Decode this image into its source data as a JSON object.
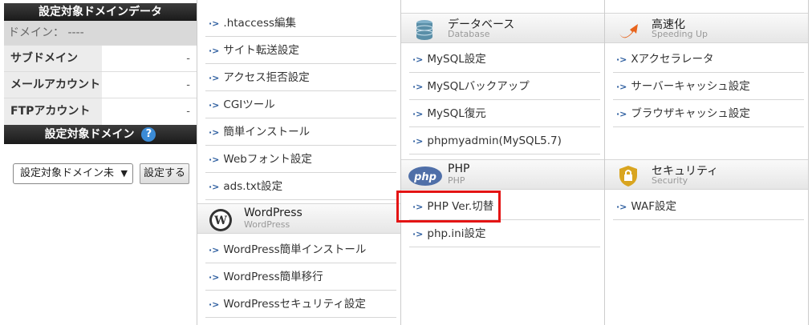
{
  "left_panel": {
    "domain_data_title": "設定対象ドメインデータ",
    "domain_line": "ドメイン： ----",
    "rows": [
      {
        "label": "サブドメイン",
        "value": "-"
      },
      {
        "label": "メールアカウント",
        "value": "-"
      },
      {
        "label": "FTPアカウント",
        "value": "-"
      }
    ],
    "target_domain_title": "設定対象ドメイン",
    "help_symbol": "?",
    "select_value": "設定対象ドメイン未",
    "set_button": "設定する"
  },
  "col1": {
    "items_top": [
      ".htaccess編集",
      "サイト転送設定",
      "アクセス拒否設定",
      "CGIツール",
      "簡単インストール",
      "Webフォント設定",
      "ads.txt設定"
    ],
    "section": {
      "title": "WordPress",
      "subtitle": "WordPress",
      "icon": "wordpress-icon"
    },
    "items_bottom": [
      "WordPress簡単インストール",
      "WordPress簡単移行",
      "WordPressセキュリティ設定"
    ]
  },
  "col2": {
    "section_db": {
      "title": "データベース",
      "subtitle": "Database",
      "icon": "database-icon"
    },
    "items_db": [
      "MySQL設定",
      "MySQLバックアップ",
      "MySQL復元",
      "phpmyadmin(MySQL5.7)"
    ],
    "section_php": {
      "title": "PHP",
      "subtitle": "PHP",
      "icon": "php-icon"
    },
    "items_php": [
      "PHP Ver.切替",
      "php.ini設定"
    ]
  },
  "col3": {
    "section_speed": {
      "title": "高速化",
      "subtitle": "Speeding Up",
      "icon": "speed-arrow-icon"
    },
    "items_speed": [
      "Xアクセラレータ",
      "サーバーキャッシュ設定",
      "ブラウザキャッシュ設定"
    ],
    "section_security": {
      "title": "セキュリティ",
      "subtitle": "Security",
      "icon": "shield-lock-icon"
    },
    "items_security": [
      "WAF設定"
    ]
  },
  "colors": {
    "highlight": "#e41414",
    "arrow": "#2b5c9e",
    "help": "#3b8bd6"
  }
}
